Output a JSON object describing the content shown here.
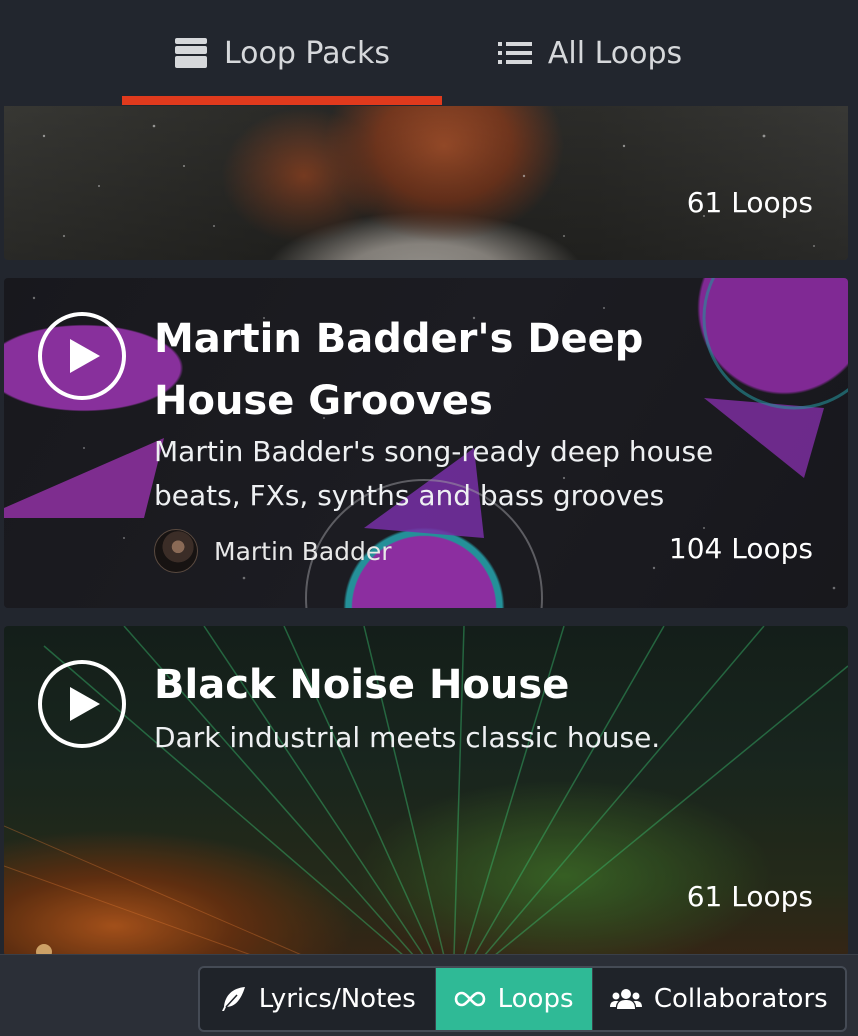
{
  "tabs": {
    "loop_packs": {
      "label": "Loop Packs",
      "icon": "stack-icon",
      "active": true
    },
    "all_loops": {
      "label": "All Loops",
      "icon": "list-icon",
      "active": false
    },
    "accent_color": "#e03a1d"
  },
  "packs": [
    {
      "title": "",
      "description": "",
      "loop_count": "61 Loops"
    },
    {
      "title": "Martin Badder's Deep House Grooves",
      "description": "Martin Badder's song-ready deep house beats, FXs, synths and bass grooves",
      "author": "Martin Badder",
      "loop_count": "104 Loops"
    },
    {
      "title": "Black Noise House",
      "description": "Dark industrial meets classic house.",
      "loop_count": "61 Loops"
    }
  ],
  "bottom_nav": {
    "lyrics": {
      "label": "Lyrics/Notes",
      "icon": "feather-icon"
    },
    "loops": {
      "label": "Loops",
      "icon": "infinity-icon",
      "active": true,
      "color": "#2fba96"
    },
    "collaborators": {
      "label": "Collaborators",
      "icon": "users-icon"
    }
  }
}
